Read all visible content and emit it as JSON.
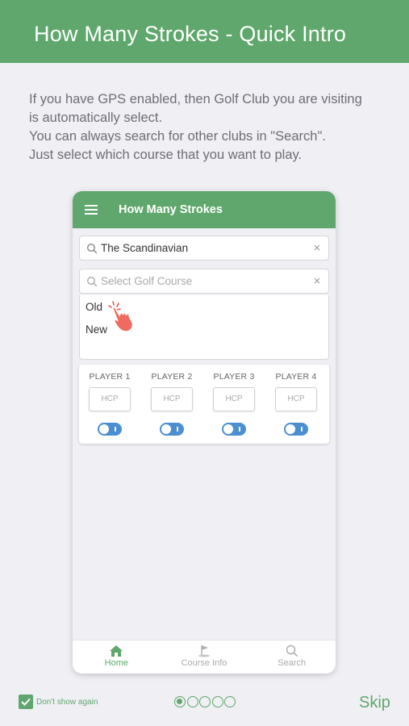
{
  "header": {
    "title": "How Many Strokes - Quick Intro"
  },
  "intro": {
    "lines": [
      "If you have GPS enabled, then Golf Club you are visiting",
      "is automatically select.",
      "You can always search for other clubs in \"Search\".",
      "Just select which course that you want to play."
    ]
  },
  "phone": {
    "title": "How Many Strokes",
    "club_search": {
      "value": "The Scandinavian",
      "clear": "×"
    },
    "course_search": {
      "placeholder": "Select Golf Course",
      "clear": "×"
    },
    "courses": [
      "Old",
      "New"
    ],
    "players": [
      {
        "label": "PLAYER 1",
        "hcp_placeholder": "HCP"
      },
      {
        "label": "PLAYER 2",
        "hcp_placeholder": "HCP"
      },
      {
        "label": "PLAYER 3",
        "hcp_placeholder": "HCP"
      },
      {
        "label": "PLAYER 4",
        "hcp_placeholder": "HCP"
      }
    ],
    "tabs": [
      {
        "label": "Home",
        "icon": "home-icon",
        "active": true
      },
      {
        "label": "Course Info",
        "icon": "golf-flag-icon",
        "active": false
      },
      {
        "label": "Search",
        "icon": "search-icon",
        "active": false
      }
    ]
  },
  "footer": {
    "dont_show_again": "Don't show again",
    "dont_show_checked": true,
    "page_count": 5,
    "current_page": 1,
    "skip": "Skip"
  },
  "colors": {
    "accent": "#5fa76c",
    "toggle": "#4c8fd1",
    "background": "#efeff4"
  }
}
